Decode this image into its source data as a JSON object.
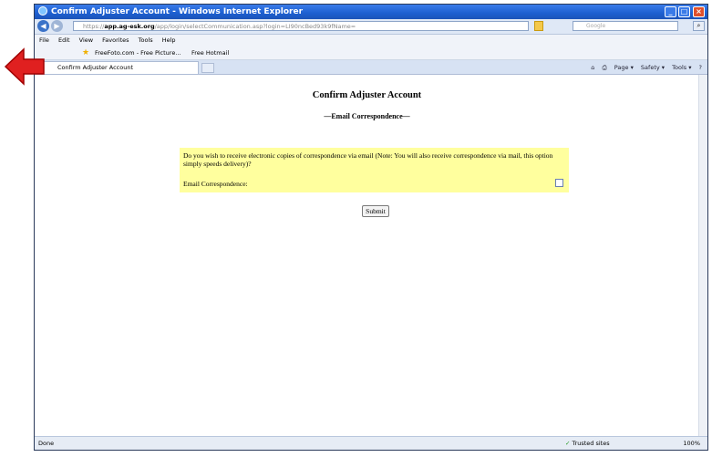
{
  "window": {
    "title": "Confirm Adjuster Account - Windows Internet Explorer"
  },
  "address": {
    "url_prefix": "https://",
    "url_host": "app.ag-esk.org",
    "url_rest": "/app/login/selectCommunication.asp?login=LI90ncBed93k9fName=",
    "search_placeholder": "Google"
  },
  "menu": {
    "items": [
      "File",
      "Edit",
      "View",
      "Favorites",
      "Tools",
      "Help"
    ]
  },
  "favorites": {
    "items": [
      "FreeFoto.com - Free Picture...",
      "Free Hotmail"
    ]
  },
  "tab": {
    "label": "Confirm Adjuster Account"
  },
  "command_bar": {
    "page": "Page ▾",
    "safety": "Safety ▾",
    "tools": "Tools ▾"
  },
  "page": {
    "title": "Confirm Adjuster Account",
    "subtitle": "—Email Correspondence—",
    "question": "Do you wish to receive electronic copies of correspondence via email (Note: You will also receive correspondence via mail, this option simply speeds delivery)?",
    "field_label": "Email Correspondence:",
    "checkbox_checked": false,
    "submit_label": "Submit"
  },
  "status": {
    "left": "Done",
    "zone": "Trusted sites",
    "zoom": "100%"
  },
  "colors": {
    "panel": "#ffff9e",
    "arrow": "#e02020",
    "titlebar": "#1d5fd0"
  }
}
